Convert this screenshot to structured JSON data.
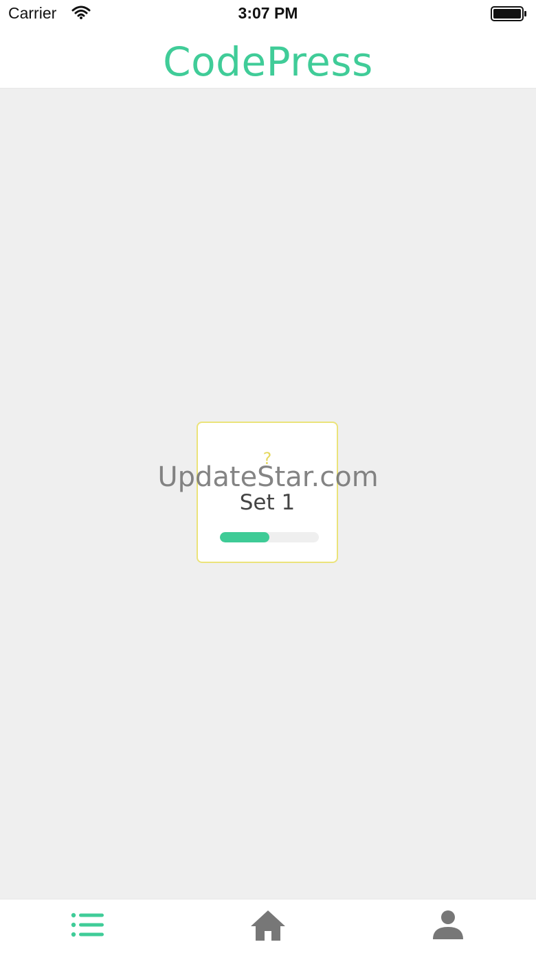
{
  "status_bar": {
    "carrier": "Carrier",
    "time": "3:07 PM",
    "icons": [
      "wifi-icon",
      "battery-icon"
    ]
  },
  "header": {
    "title": "CodePress",
    "title_color": "#40cc98"
  },
  "main": {
    "set_card": {
      "icon": "?",
      "title": "Set 1",
      "progress_fraction": 0.5,
      "border_color": "#ebe37a",
      "progress_color": "#3ecb96"
    }
  },
  "watermark": "UpdateStar.com",
  "tab_bar": {
    "items": [
      {
        "icon": "list-icon",
        "active": true,
        "color": "#40cc98"
      },
      {
        "icon": "home-icon",
        "active": false,
        "color": "#777777"
      },
      {
        "icon": "profile-icon",
        "active": false,
        "color": "#777777"
      }
    ]
  }
}
